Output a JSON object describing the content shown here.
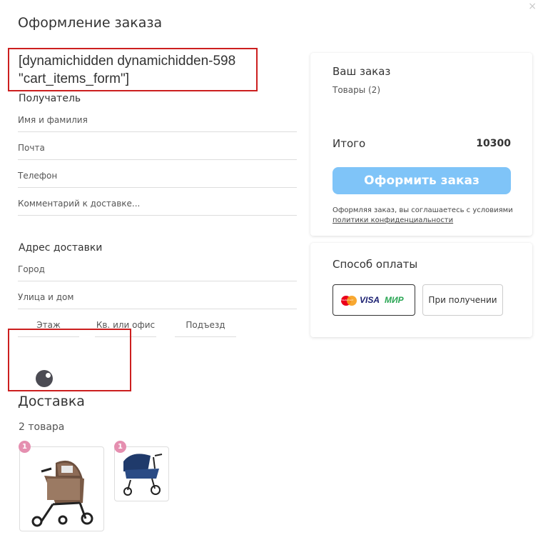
{
  "header": {
    "title": "Оформление заказа",
    "close_label": "×"
  },
  "debug_placeholder": "[dynamichidden dynamichidden-598\n\"cart_items_form\"]",
  "recipient": {
    "section_title": "Получатель",
    "name_placeholder": "Имя и фамилия",
    "email_placeholder": "Почта",
    "phone_placeholder": "Телефон",
    "comment_placeholder": "Комментарий к доставке..."
  },
  "address": {
    "section_title": "Адрес доставки",
    "city_placeholder": "Город",
    "street_placeholder": "Улица и дом",
    "floor_placeholder": "Этаж",
    "apartment_placeholder": "Кв. или офис",
    "entrance_placeholder": "Подъезд"
  },
  "delivery": {
    "title": "Доставка",
    "items_count": "2 товара",
    "items": [
      {
        "badge": "1",
        "image": "stroller-brown-icon"
      },
      {
        "badge": "1",
        "image": "stroller-blue-icon"
      }
    ]
  },
  "order_summary": {
    "title": "Ваш заказ",
    "goods_label": "Товары (2)",
    "total_label": "Итого",
    "total_value": "10300",
    "submit_label": "Оформить заказ",
    "agree_text": "Оформляя заказ, вы соглашаетесь с условиями",
    "agree_link": "политики конфиденциальности",
    "button_color": "#7fc4f8"
  },
  "payment": {
    "title": "Способ оплаты",
    "options": [
      {
        "mastercard_text": "MasterCard",
        "visa_text": "VISA",
        "mir_text": "МИР",
        "selected": true
      },
      {
        "label": "При получении",
        "selected": false
      }
    ]
  },
  "colors": {
    "badge": "#e58fb0",
    "highlight_border": "#cc1f1f"
  }
}
